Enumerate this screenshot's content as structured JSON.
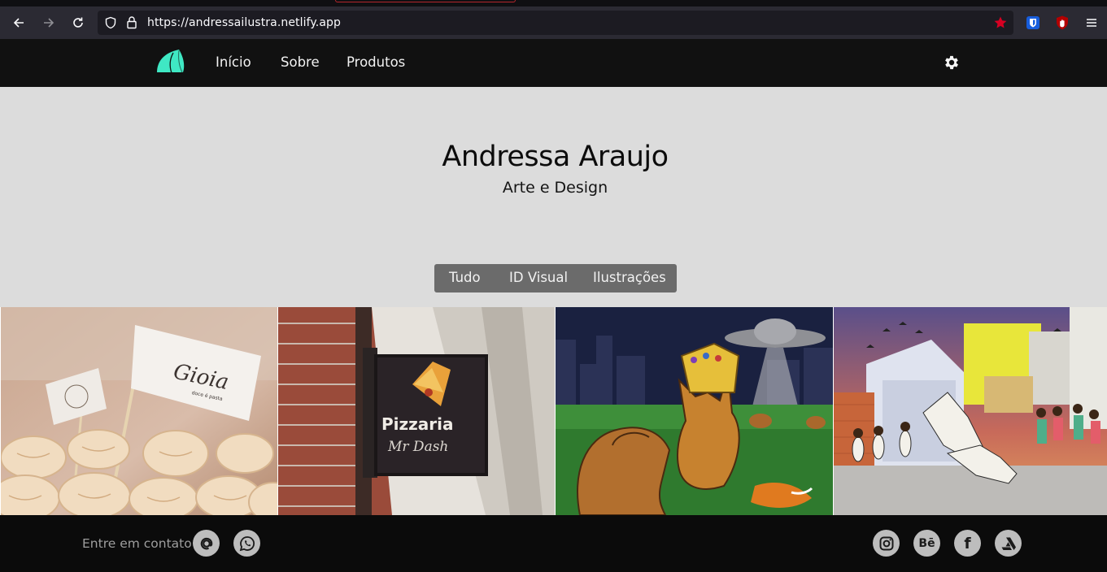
{
  "browser": {
    "url_host": "https://andressailustra.netlify.app",
    "icons": [
      "back-arrow-icon",
      "forward-arrow-icon",
      "reload-icon",
      "shield-icon",
      "lock-icon",
      "star-icon",
      "bitwarden-icon",
      "ublock-icon",
      "menu-icon"
    ],
    "bookmark_star_color": "#d70022"
  },
  "nav": {
    "links": [
      "Início",
      "Sobre",
      "Produtos"
    ],
    "logo_color": "#3fe8c4"
  },
  "hero": {
    "title": "Andressa Araujo",
    "subtitle": "Arte e Design"
  },
  "filters": [
    "Tudo",
    "ID Visual",
    "Ilustrações"
  ],
  "gallery": {
    "tiles": [
      {
        "name": "gioia-branding",
        "flag_text": "Gioia",
        "flag_tagline": "doce é pasta"
      },
      {
        "name": "pizzaria-sign",
        "sign_line1": "Pizzaria",
        "sign_line2": "Mr Dash"
      },
      {
        "name": "capybara-illustration"
      },
      {
        "name": "capoeira-illustration"
      }
    ]
  },
  "footer": {
    "contact_label": "Entre em contato",
    "contact_icons": [
      "at-icon",
      "whatsapp-icon"
    ],
    "social_icons": [
      "instagram-icon",
      "behance-icon",
      "facebook-icon",
      "artstation-icon"
    ],
    "behance_glyph": "Bē",
    "facebook_glyph": "f"
  }
}
